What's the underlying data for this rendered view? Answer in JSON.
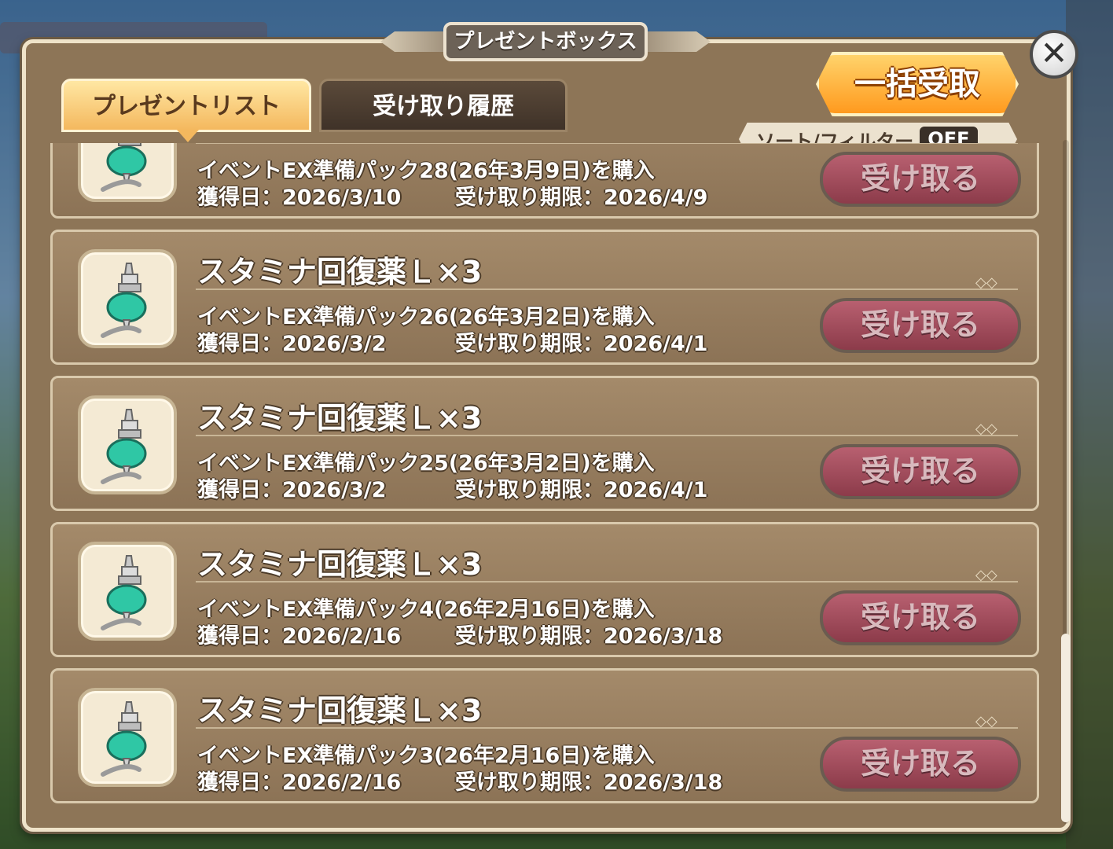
{
  "window": {
    "title": "プレゼントボックス"
  },
  "tabs": [
    {
      "label": "プレゼントリスト",
      "active": true
    },
    {
      "label": "受け取り履歴",
      "active": false
    }
  ],
  "toolbar": {
    "bulk_receive_label": "一括受取",
    "sort_filter_label": "ソート/フィルター",
    "sort_filter_state": "OFF"
  },
  "items": [
    {
      "name": "",
      "source": "イベントEX準備パック28(26年3月9日)を購入",
      "acquired": "獲得日：2026/3/10",
      "deadline": "受け取り期限：2026/4/9",
      "button": "受け取る"
    },
    {
      "name": "スタミナ回復薬Ｌ×3",
      "source": "イベントEX準備パック26(26年3月2日)を購入",
      "acquired": "獲得日：2026/3/2",
      "deadline": "受け取り期限：2026/4/1",
      "button": "受け取る"
    },
    {
      "name": "スタミナ回復薬Ｌ×3",
      "source": "イベントEX準備パック25(26年3月2日)を購入",
      "acquired": "獲得日：2026/3/2",
      "deadline": "受け取り期限：2026/4/1",
      "button": "受け取る"
    },
    {
      "name": "スタミナ回復薬Ｌ×3",
      "source": "イベントEX準備パック4(26年2月16日)を購入",
      "acquired": "獲得日：2026/2/16",
      "deadline": "受け取り期限：2026/3/18",
      "button": "受け取る"
    },
    {
      "name": "スタミナ回復薬Ｌ×3",
      "source": "イベントEX準備パック3(26年2月16日)を購入",
      "acquired": "獲得日：2026/2/16",
      "deadline": "受け取り期限：2026/3/18",
      "button": "受け取る"
    }
  ],
  "icons": {
    "close": "close-icon",
    "potion": "potion-icon"
  },
  "colors": {
    "panel": "#8d7557",
    "active_tab": "#f4b85e",
    "bulk_button": "#ff9a1e",
    "receive_button": "#8c3b4a",
    "potion_liquid": "#2fc7a5"
  }
}
